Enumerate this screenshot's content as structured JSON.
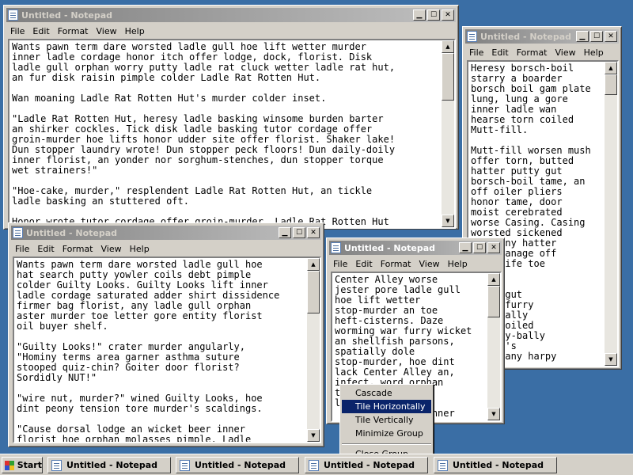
{
  "desktop_color": "#3a6ea5",
  "windows": [
    {
      "title": "Untitled - Notepad",
      "menu": [
        "File",
        "Edit",
        "Format",
        "View",
        "Help"
      ],
      "lines": [
        "Wants pawn term dare worsted ladle gull hoe lift wetter murder",
        "inner ladle cordage honor itch offer lodge, dock, florist. Disk",
        "ladle gull orphan worry putty ladle rat cluck wetter ladle rat hut,",
        "an fur disk raisin pimple colder Ladle Rat Rotten Hut.",
        "",
        "Wan moaning Ladle Rat Rotten Hut's murder colder inset.",
        "",
        "\"Ladle Rat Rotten Hut, heresy ladle basking winsome burden barter",
        "an shirker cockles. Tick disk ladle basking tutor cordage offer",
        "groin-murder hoe lifts honor udder site offer florist. Shaker lake!",
        "Dun stopper laundry wrote! Dun stopper peck floors! Dun daily-doily",
        "inner florist, an yonder nor sorghum-stenches, dun stopper torque",
        "wet strainers!\"",
        "",
        "\"Hoe-cake, murder,\" resplendent Ladle Rat Rotten Hut, an tickle",
        "ladle basking an stuttered oft.",
        "",
        "Honor wrote tutor cordage offer groin-murder, Ladle Rat Rotten Hut"
      ]
    },
    {
      "title": "Untitled - Notepad",
      "menu": [
        "File",
        "Edit",
        "Format",
        "View",
        "Help"
      ],
      "lines": [
        "Heresy borsch-boil",
        "starry a boarder",
        "borsch boil gam plate",
        "lung, lung a gore",
        "inner ladle wan",
        "hearse torn coiled",
        "Mutt-fill.",
        "",
        "Mutt-fill worsen mush",
        "offer torn, butted",
        "hatter putty gut",
        "borsch-boil tame, an",
        "off oiler pliers",
        "honor tame, door",
        "moist cerebrated",
        "worse Casing. Casing",
        "worsted sickened",
        "ent, any hatter",
        "g orphanage off",
        "punt fife toe",
        "",
        "",
        "worse gut",
        "g, an furry",
        "-spatially",
        "gull coiled",
        "ly. Any-bally",
        "Casing's",
        "hard, any harpy"
      ]
    },
    {
      "title": "Untitled - Notepad",
      "menu": [
        "File",
        "Edit",
        "Format",
        "View",
        "Help"
      ],
      "lines": [
        "Wants pawn term dare worsted ladle gull hoe",
        "hat search putty yowler coils debt pimple",
        "colder Guilty Looks. Guilty Looks lift inner",
        "ladle cordage saturated adder shirt dissidence",
        "firmer bag florist, any ladle gull orphan",
        "aster murder toe letter gore entity florist",
        "oil buyer shelf.",
        "",
        "\"Guilty Looks!\" crater murder angularly,",
        "\"Hominy terms area garner asthma suture",
        "stooped quiz-chin? Goiter door florist?",
        "Sordidly NUT!\"",
        "",
        "\"wire nut, murder?\" wined Guilty Looks, hoe",
        "dint peony tension tore murder's scaldings.",
        "",
        "\"Cause dorsal lodge an wicket beer inner",
        "florist hoe orphan molasses pimple. Ladle"
      ]
    },
    {
      "title": "Untitled - Notepad",
      "menu": [
        "File",
        "Edit",
        "Format",
        "View",
        "Help"
      ],
      "lines": [
        "Center Alley worse",
        "jester pore ladle gull",
        "hoe lift wetter",
        "stop-murder an toe",
        "heft-cisterns. Daze",
        "worming war furry wicket",
        "an shellfish parsons,",
        "spatially dole",
        "stop-murder, hoe dint",
        "lack Center Alley an,",
        "infect, word orphan",
        "tr          mar",
        "l           nner",
        "             ly inner"
      ]
    }
  ],
  "context_menu": {
    "items": [
      "Cascade",
      "Tile Horizontally",
      "Tile Vertically",
      "Minimize Group",
      "Close Group"
    ],
    "highlighted": "Tile Horizontally"
  },
  "taskbar": {
    "start_label": "Start",
    "buttons": [
      "Untitled - Notepad",
      "Untitled - Notepad",
      "Untitled - Notepad",
      "Untitled - Notepad"
    ]
  }
}
